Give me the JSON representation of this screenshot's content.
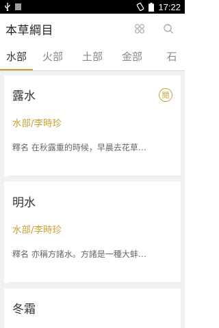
{
  "status_bar": {
    "time": "17:22",
    "icons": [
      "usb-icon",
      "notification-square-icon",
      "rotation-icon",
      "battery-icon"
    ]
  },
  "app_bar": {
    "title": "本草綱目",
    "actions": [
      "grid-icon",
      "search-icon"
    ]
  },
  "tabs": [
    {
      "label": "水部",
      "active": true
    },
    {
      "label": "火部",
      "active": false
    },
    {
      "label": "土部",
      "active": false
    },
    {
      "label": "金部",
      "active": false
    },
    {
      "label": "石",
      "active": false
    }
  ],
  "entries": [
    {
      "title": "露水",
      "source": "水部/李時珍",
      "excerpt": "釋名 在秋露重的時候，早晨去花草…",
      "badge": "閱"
    },
    {
      "title": "明水",
      "source": "水部/李時珍",
      "excerpt": "釋名 亦稱方諸水。方諸是一種大蚌…"
    },
    {
      "title": "冬霜"
    }
  ],
  "colors": {
    "accent": "#c8a032",
    "background": "#f2f2f2",
    "status_bar": "#000000"
  }
}
